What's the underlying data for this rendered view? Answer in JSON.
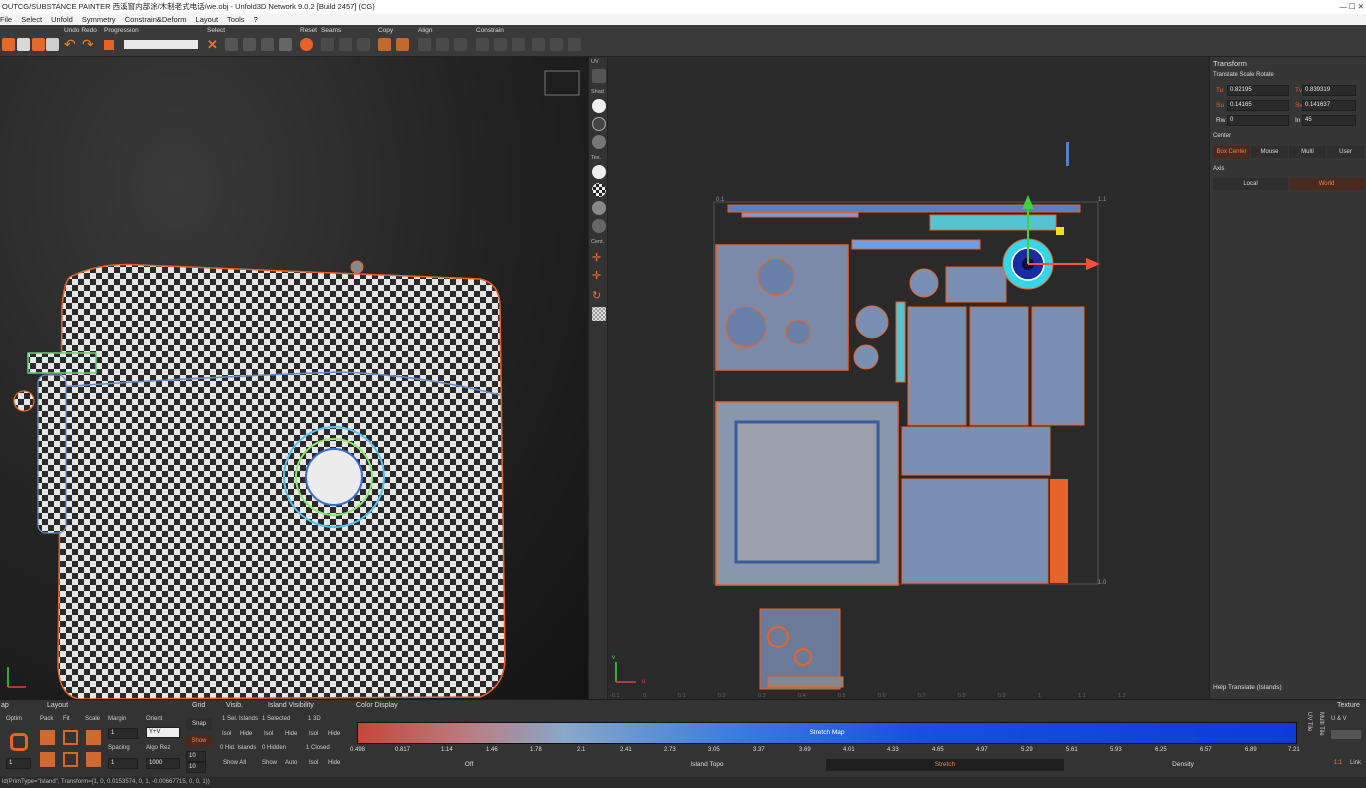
{
  "window": {
    "title": "OUTCG/SUBSTANCE PAINTER 西溪窗内部涂/木制老式电话/we.obj - Unfold3D Network 9.0.2 [Build 2457] (CG)",
    "controls": "—   ☐   ✕"
  },
  "menu": [
    "File",
    "Select",
    "Unfold",
    "Symmetry",
    "Constrain&Deform",
    "Layout",
    "Tools",
    "?"
  ],
  "toolbar": {
    "undo_redo": "Undo Redo",
    "progression": "Progression",
    "select": "Select",
    "reset": "Reset",
    "seams": "Seams",
    "copy": "Copy",
    "align": "Align",
    "constrain": "Constrain"
  },
  "sidebar": {
    "uv": "UV",
    "shad": "Shad",
    "tex": "Tex.",
    "cent": "Cent."
  },
  "uv_view": {
    "axis_u": "u",
    "axis_v": "v",
    "ticks_x": [
      "-0.1",
      "0",
      "0.1",
      "0.2",
      "0.3",
      "0.4",
      "0.5",
      "0.6",
      "0.7",
      "0.8",
      "0.9",
      "1",
      "1.1",
      "1.2"
    ],
    "corner_tl": "0.1",
    "corner_tr": "1.1",
    "corner_br": "1.0"
  },
  "transform": {
    "header": "Transform",
    "subheader": "Translate Scale Rotate",
    "tu_label": "Tu",
    "tu_value": "0.82195",
    "tv_label": "Tv",
    "tv_value": "0.839319",
    "su_label": "Su",
    "su_value": "0.14165",
    "sv_label": "Sv",
    "sv_value": "0.141637",
    "rw_label": "Rw",
    "rw_value": "0",
    "in_label": "In",
    "in_value": "45",
    "center_label": "Center",
    "center_options": [
      "Box Center",
      "Mouse",
      "Multi",
      "User"
    ],
    "center_selected": "Box Center",
    "axis_label": "Axis",
    "axis_options": [
      "Local",
      "World"
    ],
    "axis_selected": "World",
    "help": "Help Translate (Islands)"
  },
  "bottom": {
    "map_label": "ap",
    "layout_header": "Layout",
    "optim": "Optim",
    "pack": "Pack",
    "fit": "Fit",
    "scale": "Scale",
    "margin": "Margin",
    "orient": "Orient",
    "orient_value": "Y+V",
    "spacing": "Spacing",
    "algo_rez": "Algo Rez",
    "margin_value": "1",
    "spacing_value": "1",
    "algo_value": "1000",
    "left_value": "1",
    "grid_header": "Grid",
    "snap": "Snap",
    "show": "Show",
    "grid_a": "10",
    "grid_b": "10",
    "visib_header": "Visib.",
    "sel_islands": "1 Sel. Islands",
    "isol": "Isol",
    "hide": "Hide",
    "hid_islands": "0 Hid. Islands",
    "show_all": "Show All",
    "island_vis_header": "Island Visibility",
    "selected_count": "1 Selected",
    "hidden_count": "0 Hidden",
    "show_btn": "Show",
    "auto_btn": "Auto",
    "three_d": "1 3D",
    "closed": "1 Closed",
    "color_header": "Color Display",
    "stretch_label": "Stretch Map",
    "ticks": [
      "0.498",
      "0.817",
      "1.14",
      "1.46",
      "1.78",
      "2.1",
      "2.41",
      "2.73",
      "3.05",
      "3.37",
      "3.69",
      "4.01",
      "4.33",
      "4.65",
      "4.97",
      "5.29",
      "5.61",
      "5.93",
      "6.25",
      "6.57",
      "6.89",
      "7.21"
    ],
    "modes": [
      "Off",
      "Island Topo",
      "Stretch",
      "Density"
    ],
    "mode_selected": "Stretch",
    "uvtile": "UV Tile",
    "multitile": "Multi Tile",
    "texture_header": "Texture",
    "u_v": "U & V",
    "ratio": "1:1",
    "link": "Link"
  },
  "status": "ld(PrimType=\"Island\", Transform={1, 0, 0.0153574, 0, 1, -0.00667715, 0, 0, 1})",
  "colors": {
    "accent_orange": "#e8632a",
    "selection_orange": "#ff6a2b",
    "uv_blue": "#5a7ec0",
    "panel": "#363636"
  }
}
